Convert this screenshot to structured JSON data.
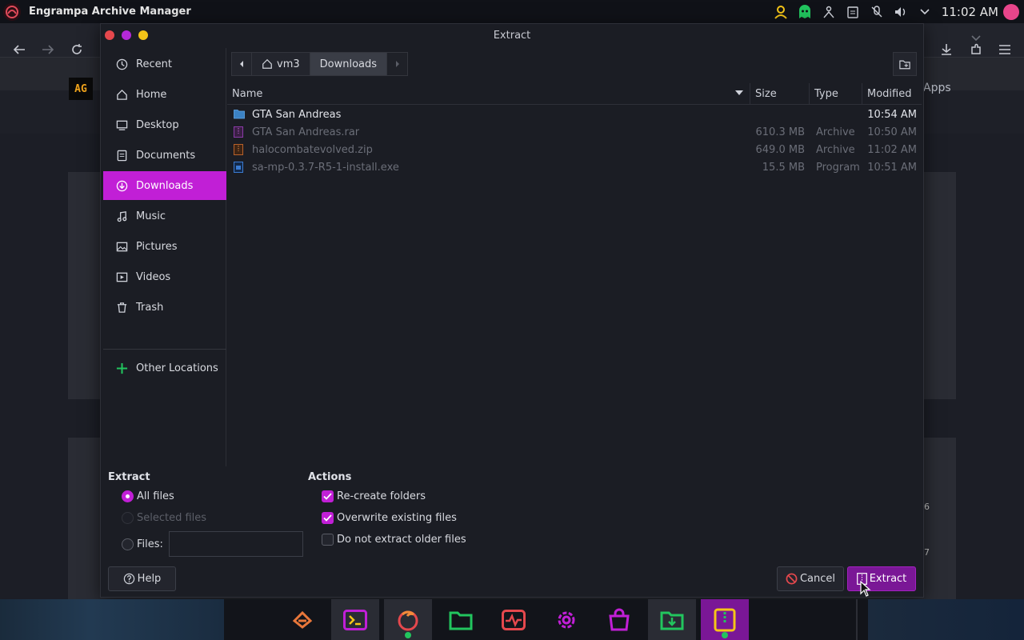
{
  "topbar": {
    "app_title": "Engrampa Archive Manager",
    "clock": "11:02 AM"
  },
  "browser": {
    "apps_label": "Apps",
    "logo_text": "AG",
    "side_numbers": [
      "6",
      "7"
    ]
  },
  "dialog": {
    "title": "Extract",
    "sidebar": [
      {
        "label": "Recent",
        "icon": "clock-icon"
      },
      {
        "label": "Home",
        "icon": "home-icon"
      },
      {
        "label": "Desktop",
        "icon": "desktop-icon"
      },
      {
        "label": "Documents",
        "icon": "documents-icon"
      },
      {
        "label": "Downloads",
        "icon": "download-icon",
        "active": true
      },
      {
        "label": "Music",
        "icon": "music-icon"
      },
      {
        "label": "Pictures",
        "icon": "pictures-icon"
      },
      {
        "label": "Videos",
        "icon": "videos-icon"
      },
      {
        "label": "Trash",
        "icon": "trash-icon"
      }
    ],
    "other_locations": "Other Locations",
    "path": {
      "home": "vm3",
      "current": "Downloads"
    },
    "columns": {
      "name": "Name",
      "size": "Size",
      "type": "Type",
      "modified": "Modified"
    },
    "files": [
      {
        "name": "GTA San Andreas",
        "size": "",
        "type": "",
        "modified": "10:54 AM",
        "icon": "folder-icon",
        "dim": false
      },
      {
        "name": "GTA San Andreas.rar",
        "size": "610.3 MB",
        "type": "Archive",
        "modified": "10:50 AM",
        "icon": "archive-icon",
        "dim": true
      },
      {
        "name": "halocombatevolved.zip",
        "size": "649.0 MB",
        "type": "Archive",
        "modified": "11:02 AM",
        "icon": "zip-icon",
        "dim": true
      },
      {
        "name": "sa-mp-0.3.7-R5-1-install.exe",
        "size": "15.5 MB",
        "type": "Program",
        "modified": "10:51 AM",
        "icon": "exe-icon",
        "dim": true
      }
    ],
    "extract_section": {
      "title": "Extract",
      "all_files": "All files",
      "selected_files": "Selected files",
      "files_label": "Files:",
      "files_value": "",
      "selected_option": "All files"
    },
    "actions_section": {
      "title": "Actions",
      "recreate_folders": "Re-create folders",
      "recreate_folders_checked": true,
      "overwrite": "Overwrite existing files",
      "overwrite_checked": true,
      "no_older": "Do not extract older files",
      "no_older_checked": false
    },
    "buttons": {
      "help": "Help",
      "cancel": "Cancel",
      "extract": "Extract"
    }
  },
  "colors": {
    "accent": "#c11fd6",
    "accent_dark": "#7a1796"
  }
}
